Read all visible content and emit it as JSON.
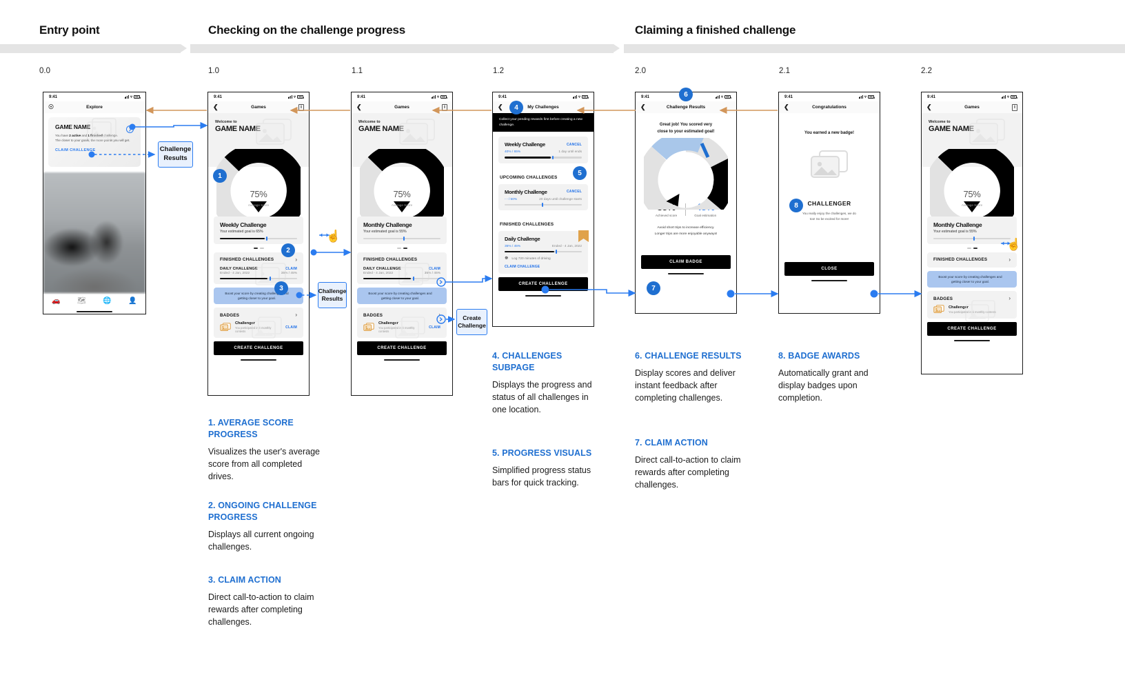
{
  "phases": [
    {
      "title": "Entry point"
    },
    {
      "title": "Checking on the challenge progress"
    },
    {
      "title": "Claiming a finished challenge"
    }
  ],
  "steps": [
    "0.0",
    "1.0",
    "1.1",
    "1.2",
    "2.0",
    "2.1",
    "2.2"
  ],
  "common": {
    "time": "9:41",
    "welcome_to": "Welcome to",
    "game_name": "GAME NAME",
    "gauge_pct": "75%",
    "gauge_label": "Average Score",
    "finished_challenges": "FINISHED CHALLENGES",
    "badges": "BADGES",
    "create_challenge": "CREATE CHALLENGE",
    "tip_text": "Boost your score by creating challenges and getting closer to your goal.",
    "badge_name": "Challenger",
    "badge_desc": "You participated in 5 monthly contests",
    "claim": "CLAIM",
    "daily_challenge": "DAILY CHALLENGE",
    "daily_ended": "Ended - 4 Jan, 2022",
    "daily_pcts": "35% / 45%",
    "nav_games": "Games"
  },
  "screen_00": {
    "title": "Explore",
    "bell_icon": "bell-icon",
    "card_title": "GAME NAME",
    "card_body_1": "You have ",
    "card_body_b1": "2 active",
    "card_body_2": " and ",
    "card_body_b2": "1 finished",
    "card_body_3": " challenge.",
    "card_body_line2": "The closer to your goals, the more points you will get.",
    "claim_label": "CLAIM CHALLENGE",
    "tabs": [
      "car-icon",
      "map-icon",
      "globe-icon",
      "person-icon"
    ]
  },
  "screen_10": {
    "nav_title": "Games",
    "challenge_title": "Weekly Challenge",
    "challenge_sub": "Your estimated goal is 65%"
  },
  "screen_11": {
    "nav_title": "Games",
    "challenge_title": "Monthly Challenge",
    "challenge_sub": "Your estimated goal is 55%"
  },
  "screen_12": {
    "nav_title": "My Challenges",
    "banner": "Collect your pending rewards first before creating a new challenge.",
    "weekly": {
      "title": "Weekly Challenge",
      "action": "CANCEL",
      "pcts": "40% / 65%",
      "meta": "1 day until ends",
      "fill": 60,
      "knob": 62
    },
    "upcoming_header": "UPCOMING CHALLENGES",
    "monthly": {
      "title": "Monthly Challenge",
      "action": "CANCEL",
      "pcts": "- - / 50%",
      "meta": "20 days until challenge starts",
      "fill": 0,
      "knob": 48
    },
    "finished_header": "FINISHED CHALLENGES",
    "daily": {
      "title": "Daily Challenge",
      "pcts": "35% / 45%",
      "meta": "Ended -  4 Jan, 2022",
      "task": "Log 720 minutes of driving",
      "claim": "CLAIM CHALLENGE",
      "fill": 64,
      "knob": 68
    },
    "cta": "CREATE CHALLENGE"
  },
  "screen_20": {
    "nav_title": "Challenge Results",
    "headline_1": "Great job! You scored very",
    "headline_2": "close to your estimated goal!",
    "achieved_value": "35%",
    "achieved_label": "Achieved score",
    "goal_value": "45%",
    "goal_label": "Goal estimation",
    "tip_1": "Avoid short trips to increase efficiency.",
    "tip_2": "Longer trips are more enjoyable anyways!",
    "cta": "CLAIM BADGE"
  },
  "screen_21": {
    "nav_title": "Congratulations",
    "headline": "You earned a new badge!",
    "badge_title": "CHALLENGER",
    "badge_body_1": "You really enjoy the challenges, we do",
    "badge_body_2": "too! So be excited for more!",
    "cta": "CLOSE"
  },
  "screen_22": {
    "nav_title": "Games",
    "challenge_title": "Monthly Challenge",
    "challenge_sub": "Your estimated goal is 55%"
  },
  "connector_labels": [
    {
      "line1": "Challenge",
      "line2": "Results"
    },
    {
      "line1": "Challenge",
      "line2": "Results"
    },
    {
      "line1": "Create",
      "line2": "Challenge"
    }
  ],
  "annotations": [
    {
      "title": "1. AVERAGE SCORE PROGRESS",
      "body": "Visualizes the user's average score from all completed drives."
    },
    {
      "title": "2. ONGOING CHALLENGE PROGRESS",
      "body": "Displays all current ongoing challenges."
    },
    {
      "title": "3. CLAIM ACTION",
      "body": "Direct call-to-action to claim rewards after completing challenges."
    },
    {
      "title": "4. CHALLENGES SUBPAGE",
      "body": "Displays the progress and status of all challenges in one location."
    },
    {
      "title": "5. PROGRESS VISUALS",
      "body": "Simplified progress status bars for quick tracking."
    },
    {
      "title": "6. CHALLENGE RESULTS",
      "body": "Display scores and deliver instant feedback after completing challenges."
    },
    {
      "title": "7. CLAIM ACTION",
      "body": "Direct call-to-action to claim rewards after completing challenges."
    },
    {
      "title": "8. BADGE AWARDS",
      "body": "Automatically grant and display badges upon completion."
    }
  ],
  "bubbles": [
    "1",
    "2",
    "3",
    "4",
    "5",
    "6",
    "7",
    "8"
  ],
  "colors": {
    "accent_blue": "#1f6fd0",
    "link_blue": "#2b7cf0",
    "back_arrow": "#d2965a",
    "tip_blue": "#aac6ef",
    "gauge_light": "#e2e2e2",
    "gauge_dark": "#000000"
  }
}
